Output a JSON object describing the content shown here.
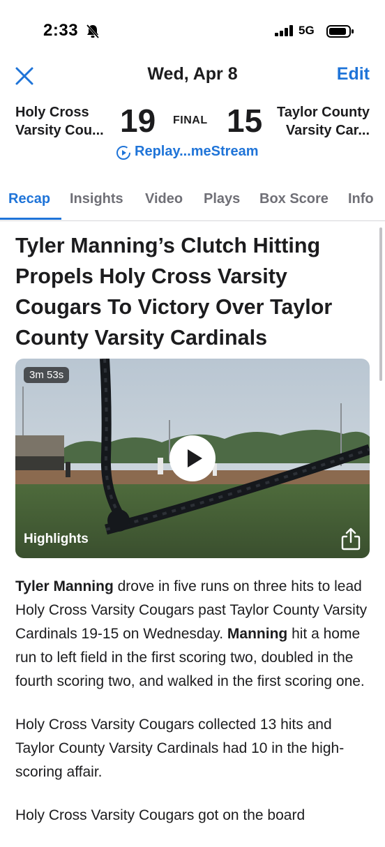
{
  "status_bar": {
    "time": "2:33",
    "network": "5G"
  },
  "nav": {
    "close_icon": "close-x-icon",
    "title": "Wed, Apr 8",
    "edit_label": "Edit"
  },
  "scoreboard": {
    "home_team_line1": "Holy Cross",
    "home_team_line2": "Varsity Cou...",
    "home_score": "19",
    "status": "FINAL",
    "away_score": "15",
    "away_team_line1": "Taylor County",
    "away_team_line2": "Varsity Car..."
  },
  "replay": {
    "icon": "replay-icon",
    "label": "Replay...meStream"
  },
  "tabs": [
    {
      "label": "Recap",
      "active": true
    },
    {
      "label": "Insights",
      "active": false
    },
    {
      "label": "Video",
      "active": false
    },
    {
      "label": "Plays",
      "active": false
    },
    {
      "label": "Box Score",
      "active": false
    },
    {
      "label": "Info",
      "active": false
    }
  ],
  "headline": "Tyler Manning’s Clutch Hitting Propels Holy Cross Varsity Cougars To Victory Over Taylor County Varsity Cardinals",
  "video": {
    "duration": "3m 53s",
    "label": "Highlights",
    "play_icon": "play-icon",
    "share_icon": "share-icon"
  },
  "article": {
    "p1_name": "Tyler Manning",
    "p1_text": " drove in five runs on three hits to lead Holy Cross Varsity Cougars past Taylor County Varsity Cardinals 19-15 on Wednesday. ",
    "p1_name2": "Manning",
    "p1_text2": " hit a home run to left field in the first scoring two, doubled in the fourth scoring two, and walked in the first scoring one.",
    "p2": "Holy Cross Varsity Cougars collected 13 hits and Taylor County Varsity Cardinals had 10 in the high-scoring affair.",
    "p3": "Holy Cross Varsity Cougars got on the board"
  },
  "colors": {
    "accent": "#1f74d8",
    "text": "#1c1c1e",
    "muted": "#6f6f76"
  }
}
